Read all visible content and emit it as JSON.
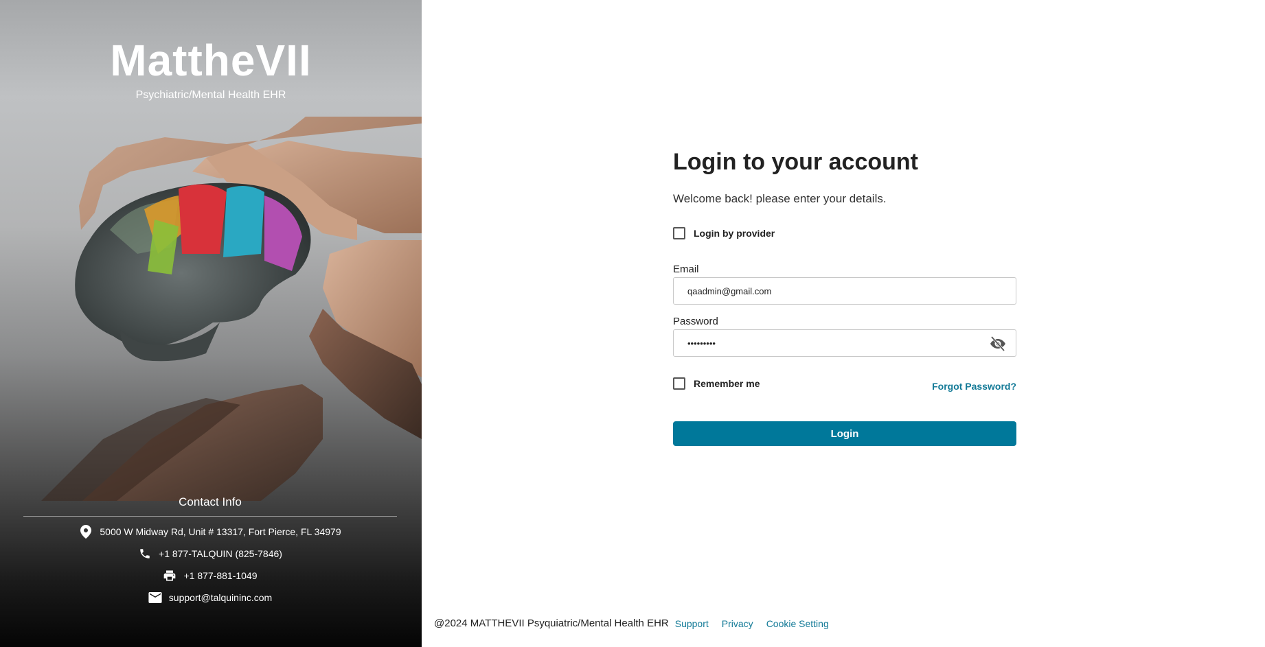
{
  "brand": {
    "title": "MattheVII",
    "subtitle": "Psychiatric/Mental Health EHR"
  },
  "contact": {
    "title": "Contact Info",
    "address": "5000 W Midway Rd, Unit # 13317, Fort Pierce, FL 34979",
    "phone": "+1 877-TALQUIN (825-7846)",
    "fax": "+1 877-881-1049",
    "email": "support@talquininc.com",
    "icons": [
      "location-pin-icon",
      "phone-icon",
      "fax-printer-icon",
      "mail-icon"
    ]
  },
  "login": {
    "title": "Login to your account",
    "subtitle": "Welcome back! please enter your details.",
    "provider_label": "Login by provider",
    "provider_checked": false,
    "email_label": "Email",
    "email_value": "qaadmin@gmail.com",
    "password_label": "Password",
    "password_value": "•••••••••",
    "remember_label": "Remember me",
    "remember_checked": false,
    "forgot_label": "Forgot Password?",
    "button_label": "Login"
  },
  "footer": {
    "copyright": "@2024 MATTHEVII Psyquiatric/Mental Health EHR",
    "links": [
      "Support",
      "Privacy",
      "Cookie Setting"
    ]
  },
  "colors": {
    "accent": "#00789a",
    "link": "#137a97"
  }
}
